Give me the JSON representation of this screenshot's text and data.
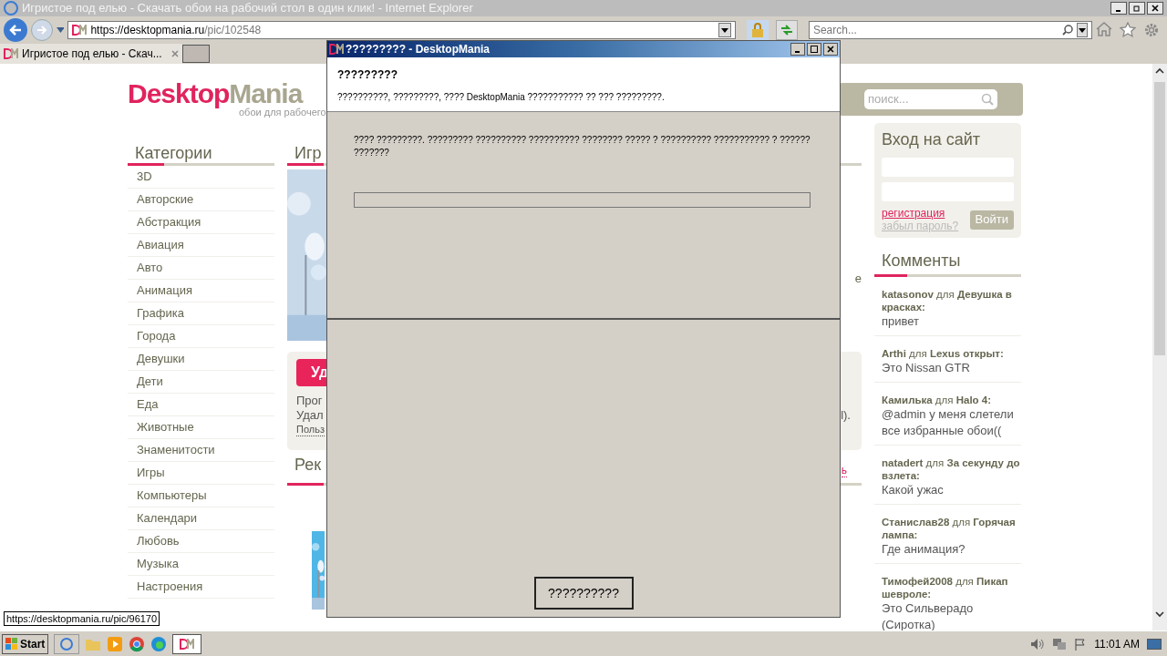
{
  "browser": {
    "title": "Игристое под елью - Скачать обои на рабочий стол в один клик! - Internet Explorer",
    "url_host": "https://desktopmania.ru",
    "url_path": "/pic/102548",
    "search_placeholder": "Search...",
    "tabs": [
      {
        "title": "Игристое под елью - Скач...",
        "selected": true
      }
    ],
    "status_link": "https://desktopmania.ru/pic/96170"
  },
  "site": {
    "logo_main": "Desktop",
    "logo_accent": "Mania",
    "tagline": "обои для рабочего",
    "search_placeholder": "поиск...",
    "categories": {
      "heading": "Категории",
      "items": [
        "3D",
        "Авторские",
        "Абстракция",
        "Авиация",
        "Авто",
        "Анимация",
        "Графика",
        "Города",
        "Девушки",
        "Дети",
        "Еда",
        "Животные",
        "Знаменитости",
        "Игры",
        "Компьютеры",
        "Календари",
        "Любовь",
        "Музыка",
        "Настроения"
      ]
    },
    "center": {
      "heading": "Игр",
      "promo_button": "Уд",
      "promo_lines": [
        "Прог",
        "Удал"
      ],
      "promo_link": "Польз",
      "promo_tail": "l).",
      "side_fragment": "е",
      "heading2": "Рек",
      "heading2_link": "ь"
    },
    "login": {
      "title": "Вход на сайт",
      "register": "регистрация",
      "forgot": "забыл пароль?",
      "button": "Войти"
    },
    "comments": {
      "heading": "Комменты",
      "items": [
        {
          "head": "**katasonov** для **Девушка в красках:**",
          "text": "привет"
        },
        {
          "head": "**Arthi** для **Lexus открыт:**",
          "text": "Это Nissan GTR"
        },
        {
          "head": "**Камилька** для **Halo 4:**",
          "text": "@admin у меня слетели все избранные обои(("
        },
        {
          "head": "**natadert** для **За секунду до взлета:**",
          "text": "Какой ужас"
        },
        {
          "head": "**Станислав28** для **Горячая лампа:**",
          "text": "Где анимация?"
        },
        {
          "head": "**Тимофей2008** для **Пикап шевроле:**",
          "text": "Это Сильверадо (Сиротка)"
        }
      ]
    }
  },
  "dialog": {
    "title": "????????? - DesktopMania",
    "header_title": "?????????",
    "header_text": "??????????, ?????????, ???? DesktopMania ??????????? ?? ??? ?????????.",
    "body_text": "???? ?????????. ????????? ?????????? ?????????? ???????? ????? ? ?????????? ??????????? ? ?????? ???????",
    "progress": {
      "level": 0
    },
    "button": "??????????"
  },
  "taskbar": {
    "start": "Start",
    "clock": "11:01 AM"
  }
}
